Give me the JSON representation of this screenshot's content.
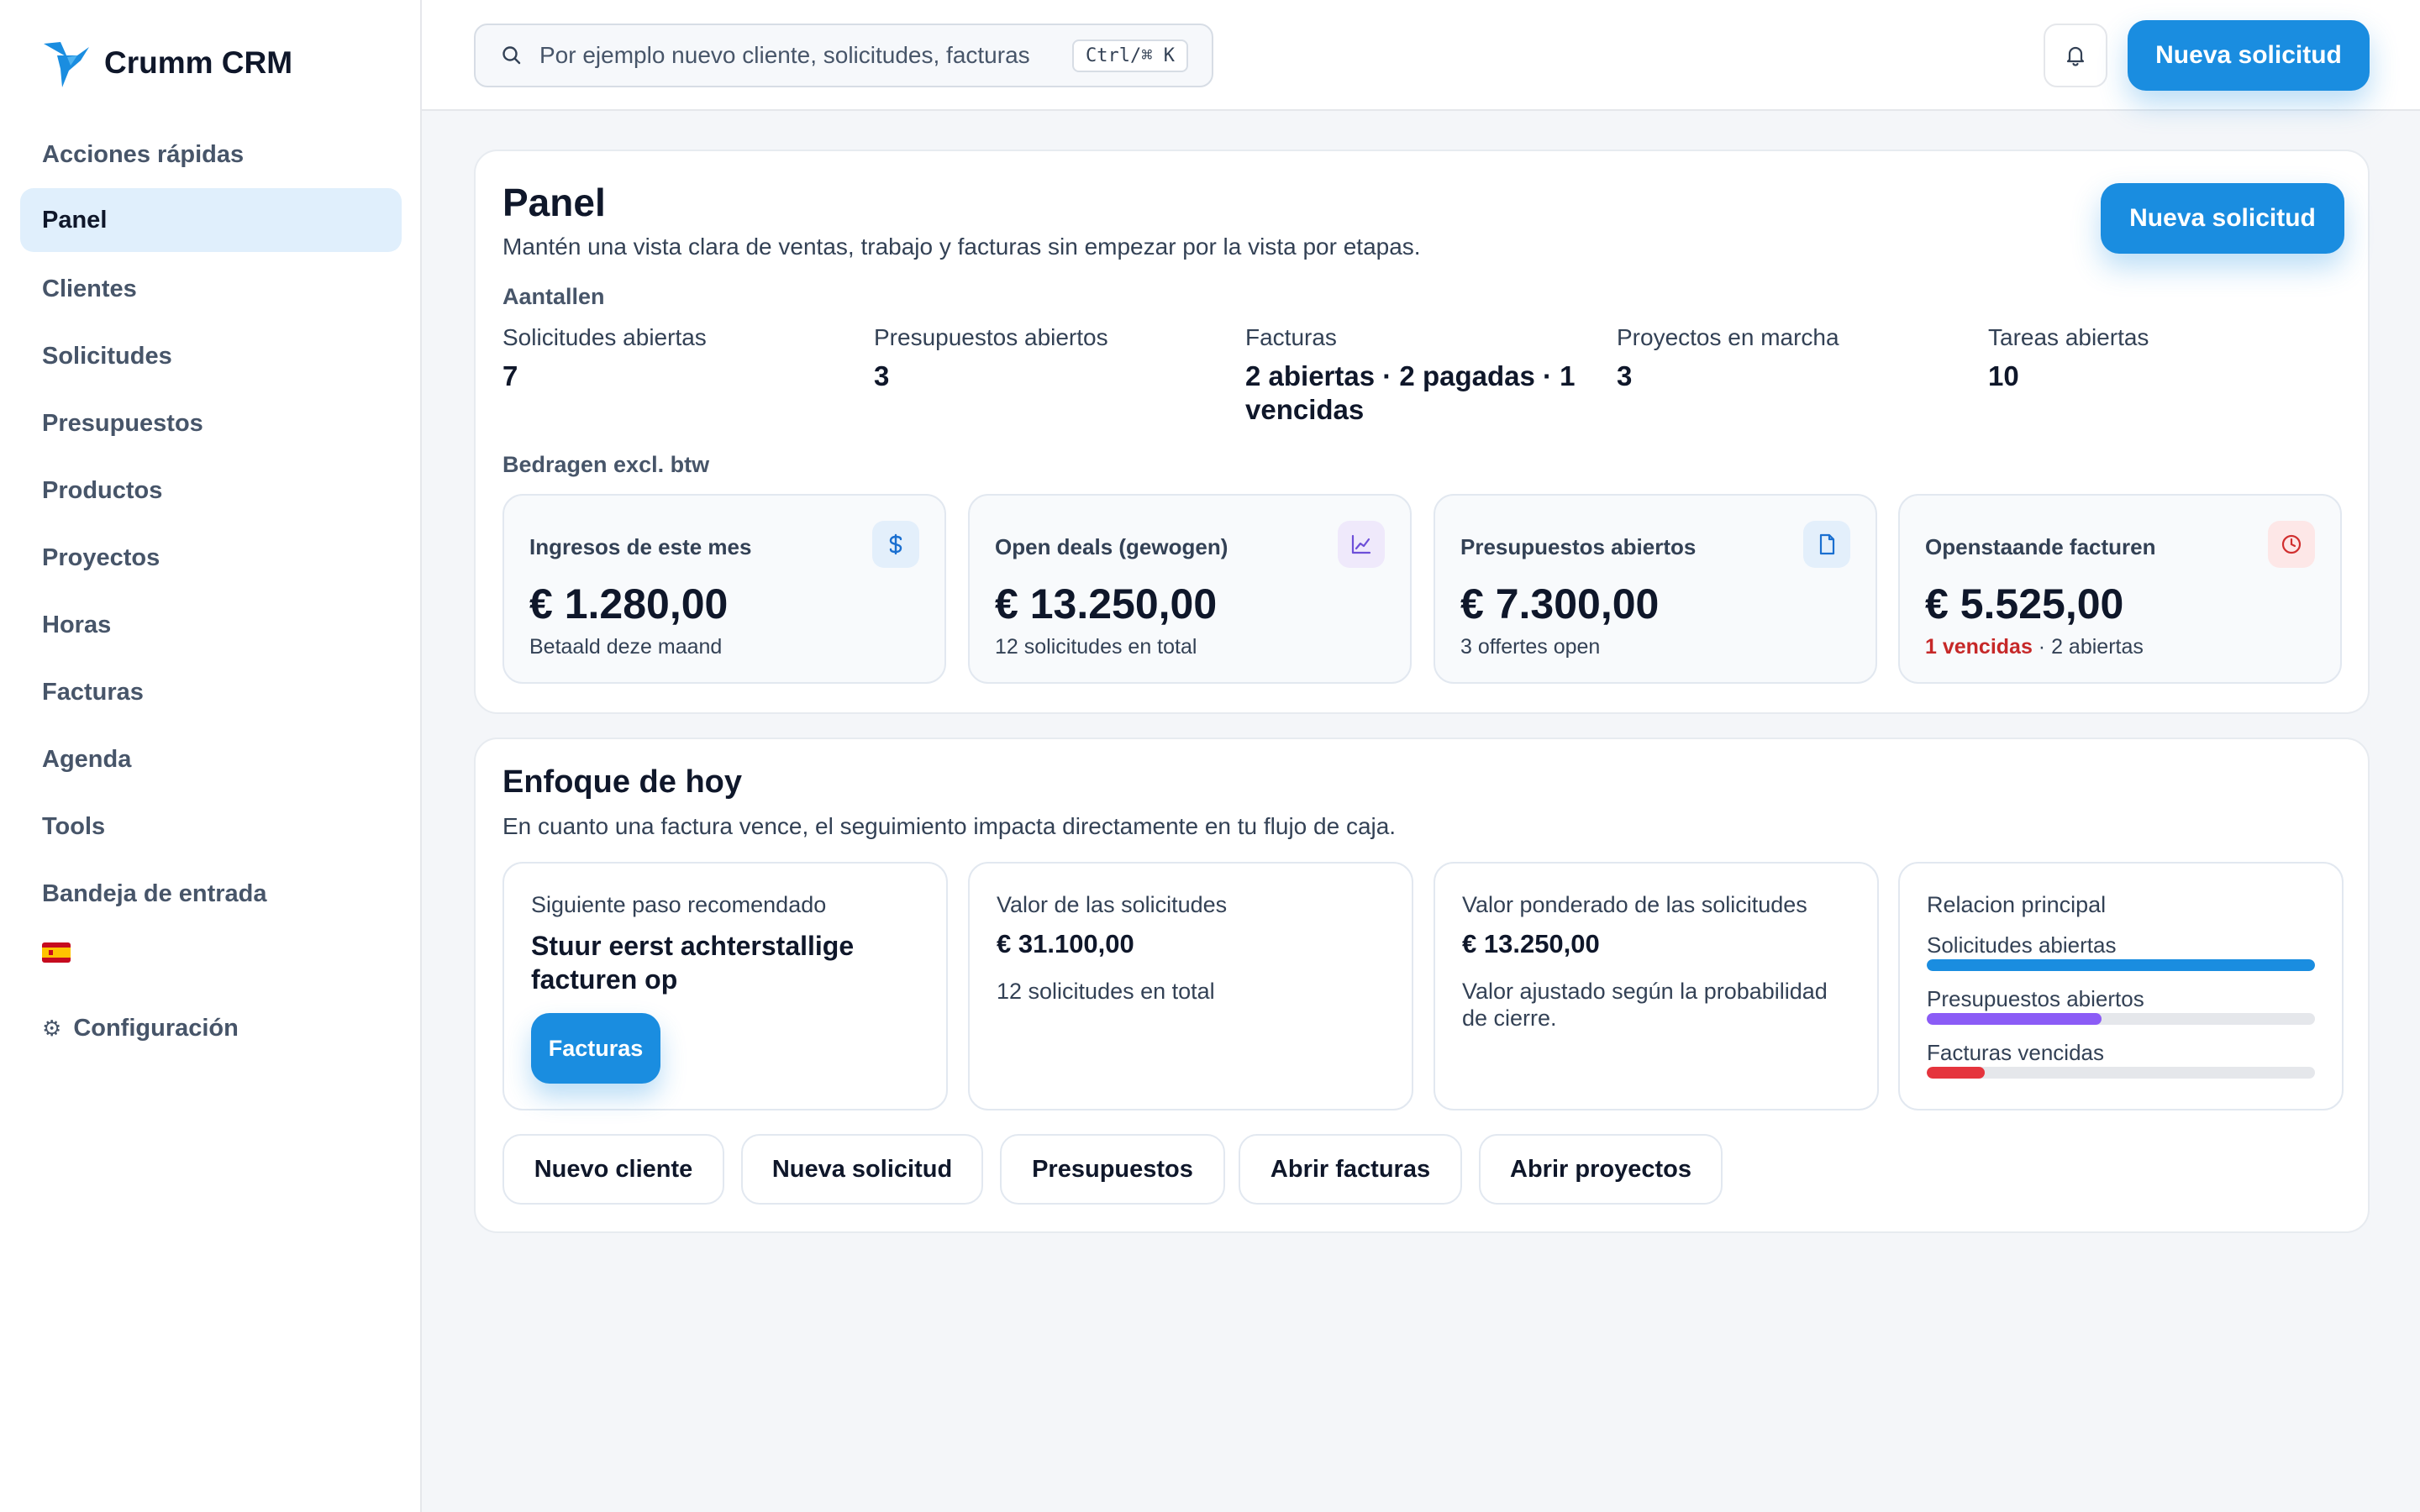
{
  "app": {
    "name": "Crumm CRM"
  },
  "sidebar": {
    "items": [
      {
        "label": "Acciones rápidas"
      },
      {
        "label": "Panel"
      },
      {
        "label": "Clientes"
      },
      {
        "label": "Solicitudes"
      },
      {
        "label": "Presupuestos"
      },
      {
        "label": "Productos"
      },
      {
        "label": "Proyectos"
      },
      {
        "label": "Horas"
      },
      {
        "label": "Facturas"
      },
      {
        "label": "Agenda"
      },
      {
        "label": "Tools"
      },
      {
        "label": "Bandeja de entrada"
      }
    ],
    "active_item": "Panel",
    "language_flag": "spain-flag",
    "config_icon": "⚙",
    "config_label": "Configuración"
  },
  "topbar": {
    "search_placeholder": "Por ejemplo nuevo cliente, solicitudes, facturas",
    "search_shortcut": "Ctrl/⌘ K",
    "primary_button": "Nueva solicitud"
  },
  "panel": {
    "title": "Panel",
    "subtitle": "Mantén una vista clara de ventas, trabajo y facturas sin empezar por la vista por etapas.",
    "new_button": "Nueva solicitud",
    "counts_heading": "Aantallen",
    "counts": [
      {
        "label": "Solicitudes abiertas",
        "value": "7"
      },
      {
        "label": "Presupuestos abiertos",
        "value": "3"
      },
      {
        "label": "Facturas",
        "value": "2 abiertas · 2 pagadas · 1 vencidas"
      },
      {
        "label": "Proyectos en marcha",
        "value": "3"
      },
      {
        "label": "Tareas abiertas",
        "value": "10"
      }
    ],
    "amounts_heading": "Bedragen excl. btw",
    "metrics": [
      {
        "label": "Ingresos de este mes",
        "value": "€ 1.280,00",
        "sub": "Betaald deze maand",
        "icon": "dollar-icon"
      },
      {
        "label": "Open deals (gewogen)",
        "value": "€ 13.250,00",
        "sub": "12 solicitudes en total",
        "icon": "chart-line-icon"
      },
      {
        "label": "Presupuestos abiertos",
        "value": "€ 7.300,00",
        "sub": "3 offertes open",
        "icon": "document-icon"
      },
      {
        "label": "Openstaande facturen",
        "value": "€ 5.525,00",
        "sub_danger": "1 vencidas",
        "sub_rest": " · 2 abiertas",
        "icon": "clock-icon"
      }
    ]
  },
  "focus": {
    "title": "Enfoque de hoy",
    "subtitle": "En cuanto una factura vence, el seguimiento impacta directamente en tu flujo de caja.",
    "next_step": {
      "label": "Siguiente paso recomendado",
      "text": "Stuur eerst achterstallige facturen op",
      "button": "Facturas"
    },
    "requests_value": {
      "label": "Valor de las solicitudes",
      "value": "€ 31.100,00",
      "desc": "12 solicitudes en total"
    },
    "weighted_value": {
      "label": "Valor ponderado de las solicitudes",
      "value": "€ 13.250,00",
      "desc": "Valor ajustado según la probabilidad de cierre."
    },
    "relations": {
      "label": "Relacion principal",
      "bars": [
        {
          "label": "Solicitudes abiertas",
          "fraction": 1.0,
          "color": "#1a8de0"
        },
        {
          "label": "Presupuestos abiertos",
          "fraction": 0.45,
          "color": "#8b5cf6"
        },
        {
          "label": "Facturas vencidas",
          "fraction": 0.15,
          "color": "#e5343d"
        }
      ]
    },
    "quick_actions": [
      {
        "label": "Nuevo cliente"
      },
      {
        "label": "Nueva solicitud"
      },
      {
        "label": "Presupuestos"
      },
      {
        "label": "Abrir facturas"
      },
      {
        "label": "Abrir proyectos"
      }
    ]
  },
  "colors": {
    "accent": "#1a8de0",
    "danger": "#c62828",
    "active_nav_bg": "#e0effc"
  }
}
